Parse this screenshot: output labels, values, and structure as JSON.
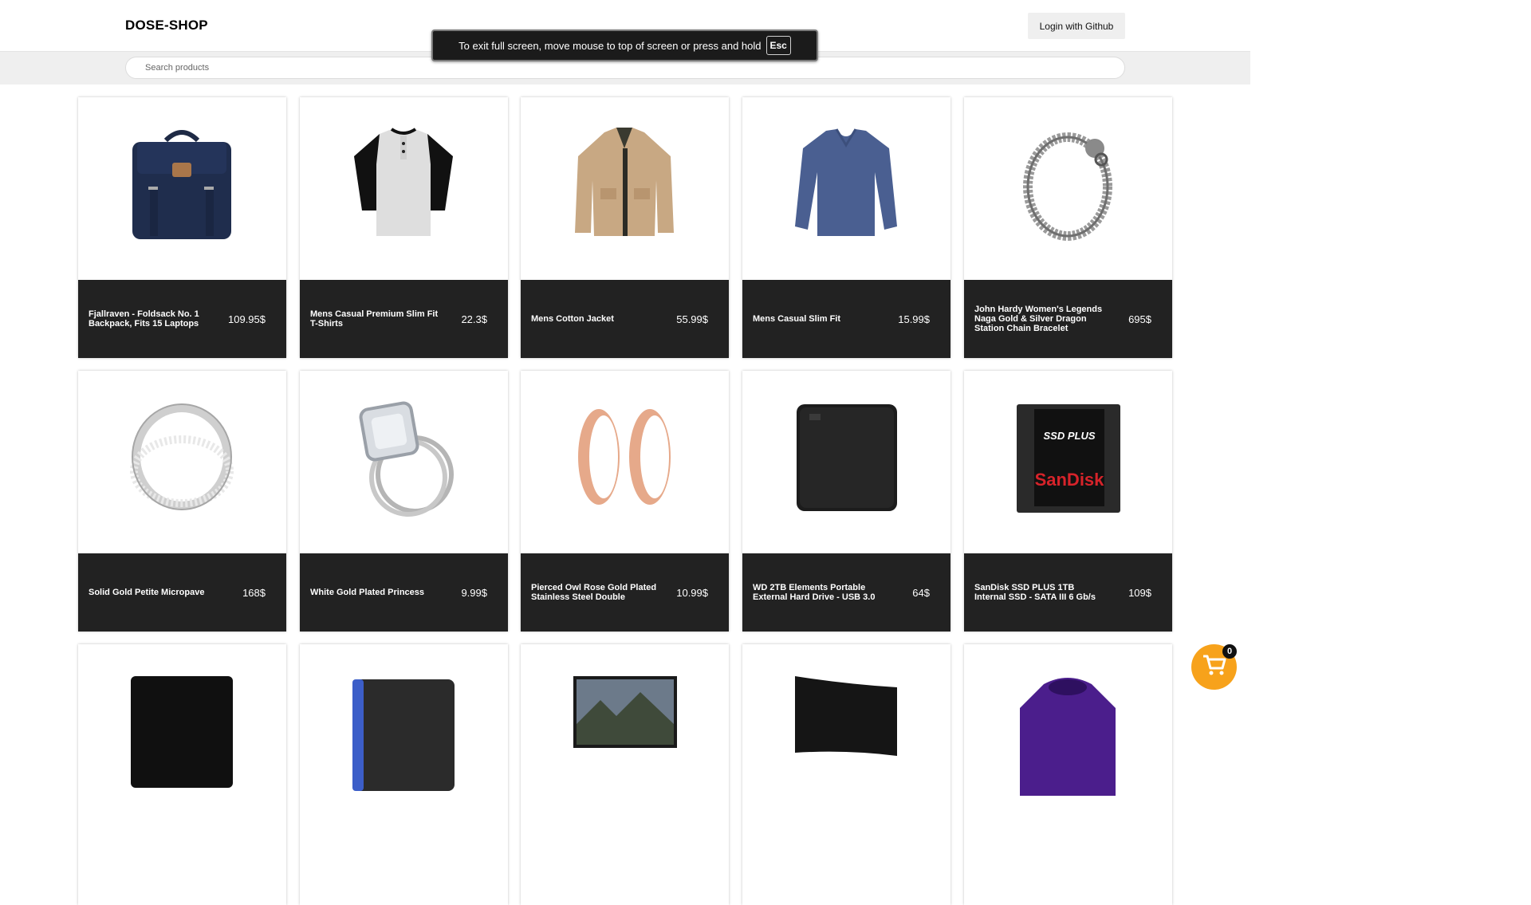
{
  "header": {
    "brand": "DOSE-SHOP",
    "login_label": "Login with Github"
  },
  "search": {
    "placeholder": "Search products",
    "value": ""
  },
  "fullscreen_toast": {
    "message": "To exit full screen, move mouse to top of screen or press and hold",
    "key": "Esc"
  },
  "products": [
    {
      "name": "Fjallraven - Foldsack No. 1 Backpack, Fits 15 Laptops",
      "price": "109.95$",
      "icon": "backpack-image"
    },
    {
      "name": "Mens Casual Premium Slim Fit T-Shirts",
      "price": "22.3$",
      "icon": "tshirt-image"
    },
    {
      "name": "Mens Cotton Jacket",
      "price": "55.99$",
      "icon": "jacket-image"
    },
    {
      "name": "Mens Casual Slim Fit",
      "price": "15.99$",
      "icon": "longsleeve-shirt-image"
    },
    {
      "name": "John Hardy Women's Legends Naga Gold & Silver Dragon Station Chain Bracelet",
      "price": "695$",
      "icon": "bracelet-image"
    },
    {
      "name": "Solid Gold Petite Micropave",
      "price": "168$",
      "icon": "ring-image"
    },
    {
      "name": "White Gold Plated Princess",
      "price": "9.99$",
      "icon": "diamond-ring-image"
    },
    {
      "name": "Pierced Owl Rose Gold Plated Stainless Steel Double",
      "price": "10.99$",
      "icon": "plugs-image"
    },
    {
      "name": "WD 2TB Elements Portable External Hard Drive - USB 3.0",
      "price": "64$",
      "icon": "hard-drive-image"
    },
    {
      "name": "SanDisk SSD PLUS 1TB Internal SSD - SATA III 6 Gb/s",
      "price": "109$",
      "icon": "ssd-image"
    },
    {
      "name": "",
      "price": "",
      "icon": "ssd-black-image"
    },
    {
      "name": "",
      "price": "",
      "icon": "gaming-drive-image"
    },
    {
      "name": "",
      "price": "",
      "icon": "monitor-image"
    },
    {
      "name": "",
      "price": "",
      "icon": "curved-monitor-image"
    },
    {
      "name": "",
      "price": "",
      "icon": "purple-jacket-image"
    }
  ],
  "ssd_label": {
    "line1": "SSD PLUS",
    "brand": "SanDisk"
  },
  "cart": {
    "count": "0",
    "icon": "cart-icon"
  },
  "colors": {
    "card_info_bg": "#222222",
    "cart_bg": "#f7a21b",
    "header_bg": "#ffffff",
    "searchbar_bg": "#efefef"
  }
}
